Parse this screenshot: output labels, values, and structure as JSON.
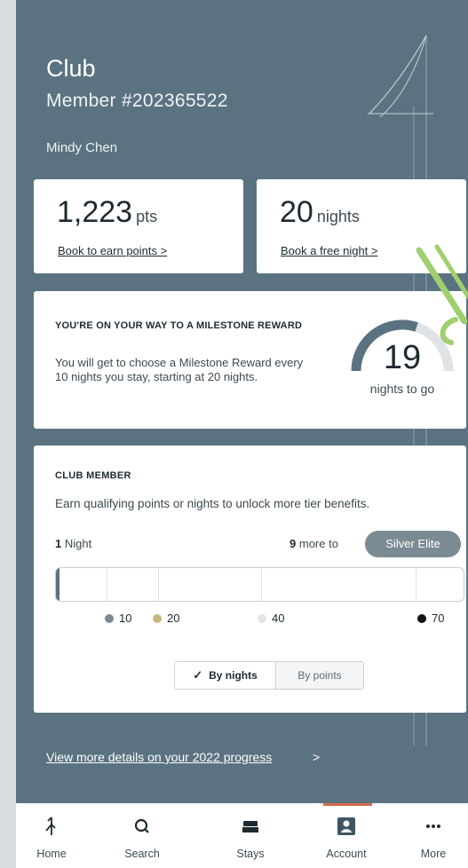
{
  "header": {
    "title": "Club",
    "member_number": "Member #202365522",
    "member_name": "Mindy Chen"
  },
  "points_card": {
    "value": "1,223",
    "unit": "pts",
    "link": "Book to earn points >"
  },
  "nights_card": {
    "value": "20",
    "unit": "nights",
    "link": "Book a free night >"
  },
  "milestone": {
    "title": "YOU'RE ON YOUR WAY TO A MILESTONE REWARD",
    "text": "You will get to choose a Milestone Reward every 10 nights you stay, starting at 20 nights.",
    "nights_to_go": "19",
    "nights_to_go_label": "nights to go",
    "progress_fraction": 0.6
  },
  "tier": {
    "title": "CLUB MEMBER",
    "description": "Earn qualifying points or nights to unlock more tier benefits.",
    "current_count": "1",
    "current_label": "Night",
    "more_count": "9",
    "more_text": "more to",
    "next_tier": "Silver Elite",
    "progress_nights": 1,
    "scale_max_nights": 70,
    "markers": [
      {
        "label": "10",
        "color": "#7f8a8f"
      },
      {
        "label": "20",
        "color": "#c9b883"
      },
      {
        "label": "40",
        "color": "#e2e5e7"
      },
      {
        "label": "70",
        "color": "#111111"
      }
    ],
    "toggle": {
      "by_nights": "By nights",
      "by_points": "By points",
      "selected": "By nights"
    }
  },
  "details_link": "View more details on your 2022 progress",
  "details_chevron": ">",
  "nav": {
    "items": [
      {
        "label": "Home",
        "icon": "home-logo-icon"
      },
      {
        "label": "Search",
        "icon": "search-icon"
      },
      {
        "label": "Stays",
        "icon": "bed-icon"
      },
      {
        "label": "Account",
        "icon": "account-icon",
        "active": true
      },
      {
        "label": "More",
        "icon": "more-icon"
      }
    ]
  },
  "colors": {
    "hero_background": "#5b7380",
    "accent_active": "#d36a4d",
    "pill": "#7b8b93",
    "decor_green": "#9fcf6e"
  }
}
